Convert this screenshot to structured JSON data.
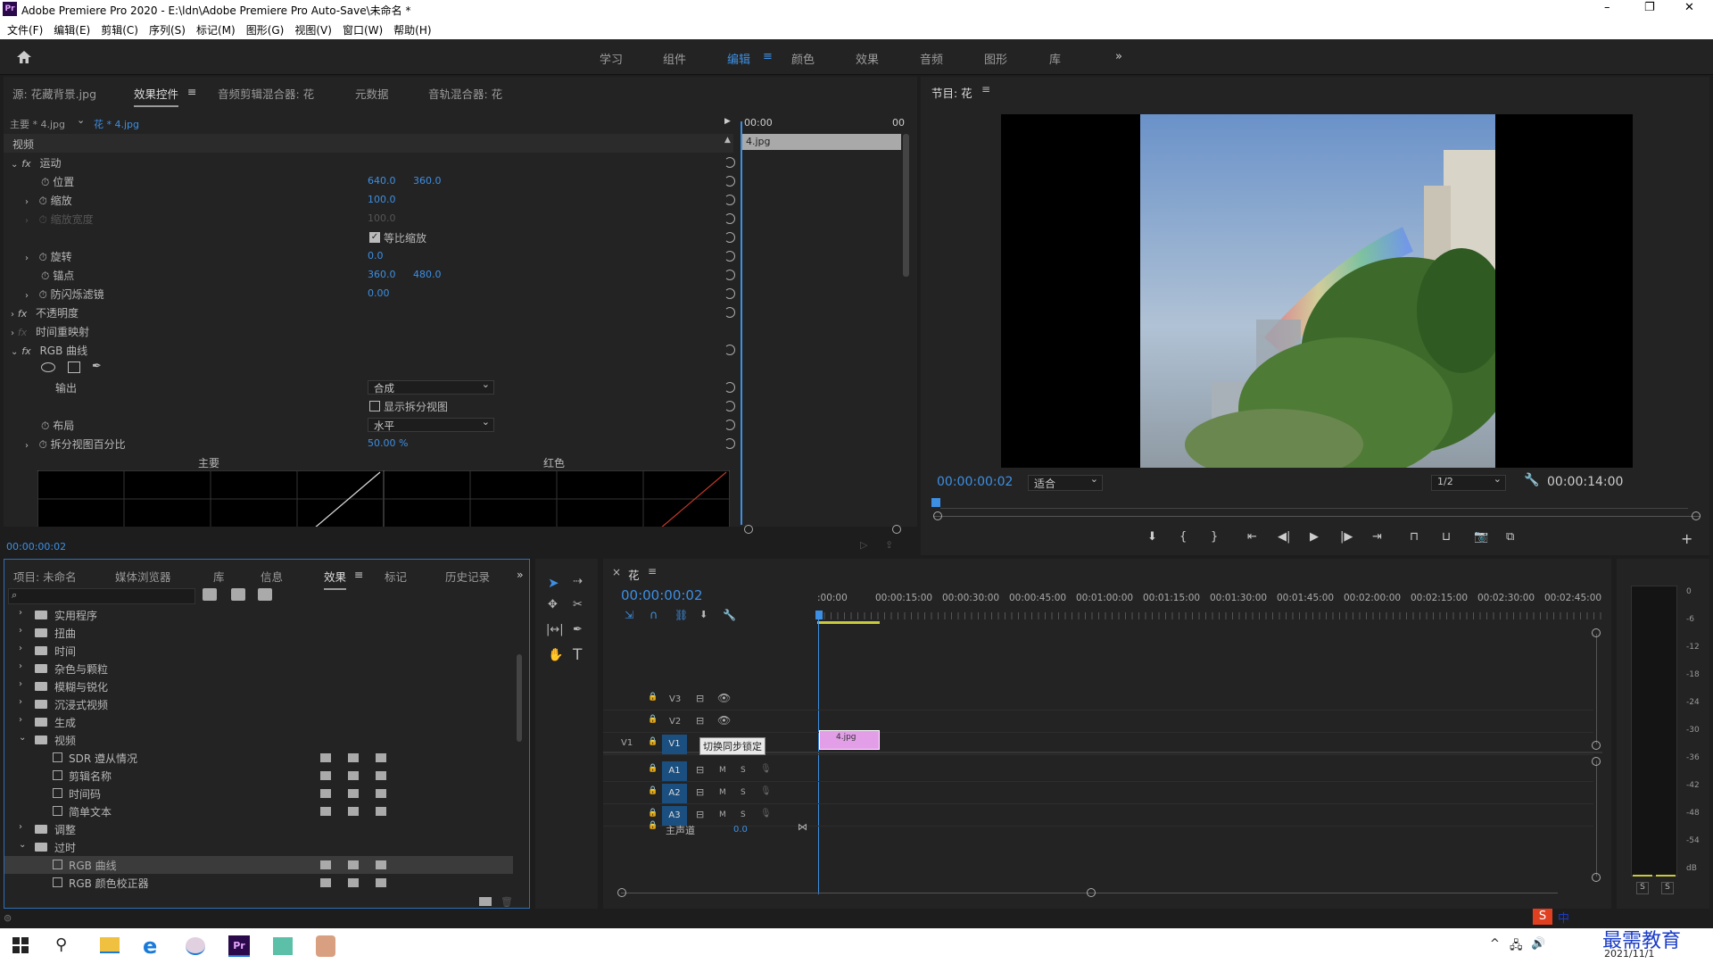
{
  "titlebar": {
    "app_icon": "Pr",
    "title": "Adobe Premiere Pro 2020 - E:\\ldn\\Adobe Premiere Pro Auto-Save\\未命名 *",
    "minimize": "–",
    "maximize": "❐",
    "close": "✕"
  },
  "menu": [
    "文件(F)",
    "编辑(E)",
    "剪辑(C)",
    "序列(S)",
    "标记(M)",
    "图形(G)",
    "视图(V)",
    "窗口(W)",
    "帮助(H)"
  ],
  "workspaces": [
    "学习",
    "组件",
    "编辑",
    "颜色",
    "效果",
    "音频",
    "图形",
    "库"
  ],
  "workspace_active": "编辑",
  "workspace_more": "»",
  "source_panel": {
    "tabs": [
      "源: 花藏背景.jpg",
      "效果控件",
      "音频剪辑混合器: 花",
      "元数据",
      "音轨混合器: 花"
    ],
    "active_tab": "效果控件",
    "clip_master": "主要 * 4.jpg",
    "clip_sel": "花 * 4.jpg",
    "timecode_start": "00:00",
    "timecode_end": "00",
    "clip_label": "4.jpg",
    "section": "视频",
    "motion": "运动",
    "position": "位置",
    "position_x": "640.0",
    "position_y": "360.0",
    "scale": "缩放",
    "scale_val": "100.0",
    "scale_w": "缩放宽度",
    "scale_w_val": "100.0",
    "uniform": "等比缩放",
    "rotation": "旋转",
    "rotation_val": "0.0",
    "anchor": "锚点",
    "anchor_x": "360.0",
    "anchor_y": "480.0",
    "flicker": "防闪烁滤镜",
    "flicker_val": "0.00",
    "opacity": "不透明度",
    "remap": "时间重映射",
    "curves": "RGB 曲线",
    "output": "输出",
    "output_val": "合成",
    "split": "显示拆分视图",
    "layout": "布局",
    "layout_val": "水平",
    "split_pct": "拆分视图百分比",
    "split_pct_val": "50.00 %",
    "master": "主要",
    "red": "红色",
    "timecode": "00:00:00:02"
  },
  "program": {
    "title": "节目: 花",
    "timecode": "00:00:00:02",
    "fit": "适合",
    "res": "1/2",
    "duration": "00:00:14:00"
  },
  "project_panel": {
    "tabs": [
      "项目: 未命名",
      "媒体浏览器",
      "库",
      "信息",
      "效果",
      "标记",
      "历史记录"
    ],
    "active_tab": "效果",
    "more": "»",
    "folders": [
      "实用程序",
      "扭曲",
      "时间",
      "杂色与颗粒",
      "模糊与锐化",
      "沉浸式视频",
      "生成",
      "视频"
    ],
    "video_items": [
      "SDR 遵从情况",
      "剪辑名称",
      "时间码",
      "简单文本"
    ],
    "more_folders": [
      "调整",
      "过时"
    ],
    "obsolete_items": [
      "RGB 曲线",
      "RGB 颜色校正器"
    ]
  },
  "timeline": {
    "title": "花",
    "close": "×",
    "timecode": "00:00:00:02",
    "ruler": [
      ":00:00",
      "00:00:15:00",
      "00:00:30:00",
      "00:00:45:00",
      "00:01:00:00",
      "00:01:15:00",
      "00:01:30:00",
      "00:01:45:00",
      "00:02:00:00",
      "00:02:15:00",
      "00:02:30:00",
      "00:02:45:00"
    ],
    "video_tracks": [
      "V3",
      "V2",
      "V1"
    ],
    "audio_tracks": [
      "A1",
      "A2",
      "A3"
    ],
    "src_v1": "V1",
    "tooltip": "切换同步锁定",
    "clip": "4.jpg",
    "master": "主声道",
    "master_val": "0.0",
    "m": "M",
    "s": "S"
  },
  "meter": {
    "labels": [
      "0",
      "-6",
      "-12",
      "-18",
      "-24",
      "-30",
      "-36",
      "-42",
      "-48",
      "-54",
      "dB"
    ],
    "solo": [
      "S",
      "S"
    ]
  },
  "taskbar": {
    "date": "2021/11/1",
    "watermark": "最需教育",
    "ime": "中"
  }
}
